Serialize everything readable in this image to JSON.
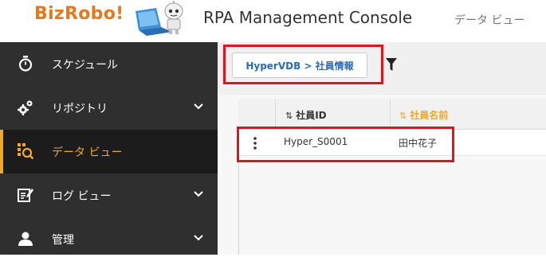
{
  "header": {
    "logo_text": "BizRobo!",
    "title": "RPA Management Console",
    "view_label": "データ ビュー"
  },
  "sidebar": {
    "items": [
      {
        "label": "スケジュール",
        "icon": "stopwatch-icon"
      },
      {
        "label": "リポジトリ",
        "icon": "gears-icon",
        "expandable": true
      },
      {
        "label": "データ ビュー",
        "icon": "data-view-icon",
        "active": true
      },
      {
        "label": "ログ ビュー",
        "icon": "log-edit-icon",
        "expandable": true
      },
      {
        "label": "管理",
        "icon": "user-icon",
        "expandable": true
      }
    ]
  },
  "toolbar": {
    "breadcrumb": "HyperVDB > 社員情報",
    "filter_icon": "filter-icon"
  },
  "table": {
    "columns": [
      {
        "label": "社員ID",
        "sort_icon": "⇅"
      },
      {
        "label": "社員名前",
        "sort_icon": "⇅"
      }
    ],
    "rows": [
      {
        "id": "Hyper_S0001",
        "name": "田中花子"
      }
    ]
  },
  "colors": {
    "accent": "#f5a623",
    "brand_orange": "#e8781c",
    "sidebar_bg": "#2f2f2f",
    "highlight_red": "#e0141e",
    "link_blue": "#2b6cb0"
  }
}
